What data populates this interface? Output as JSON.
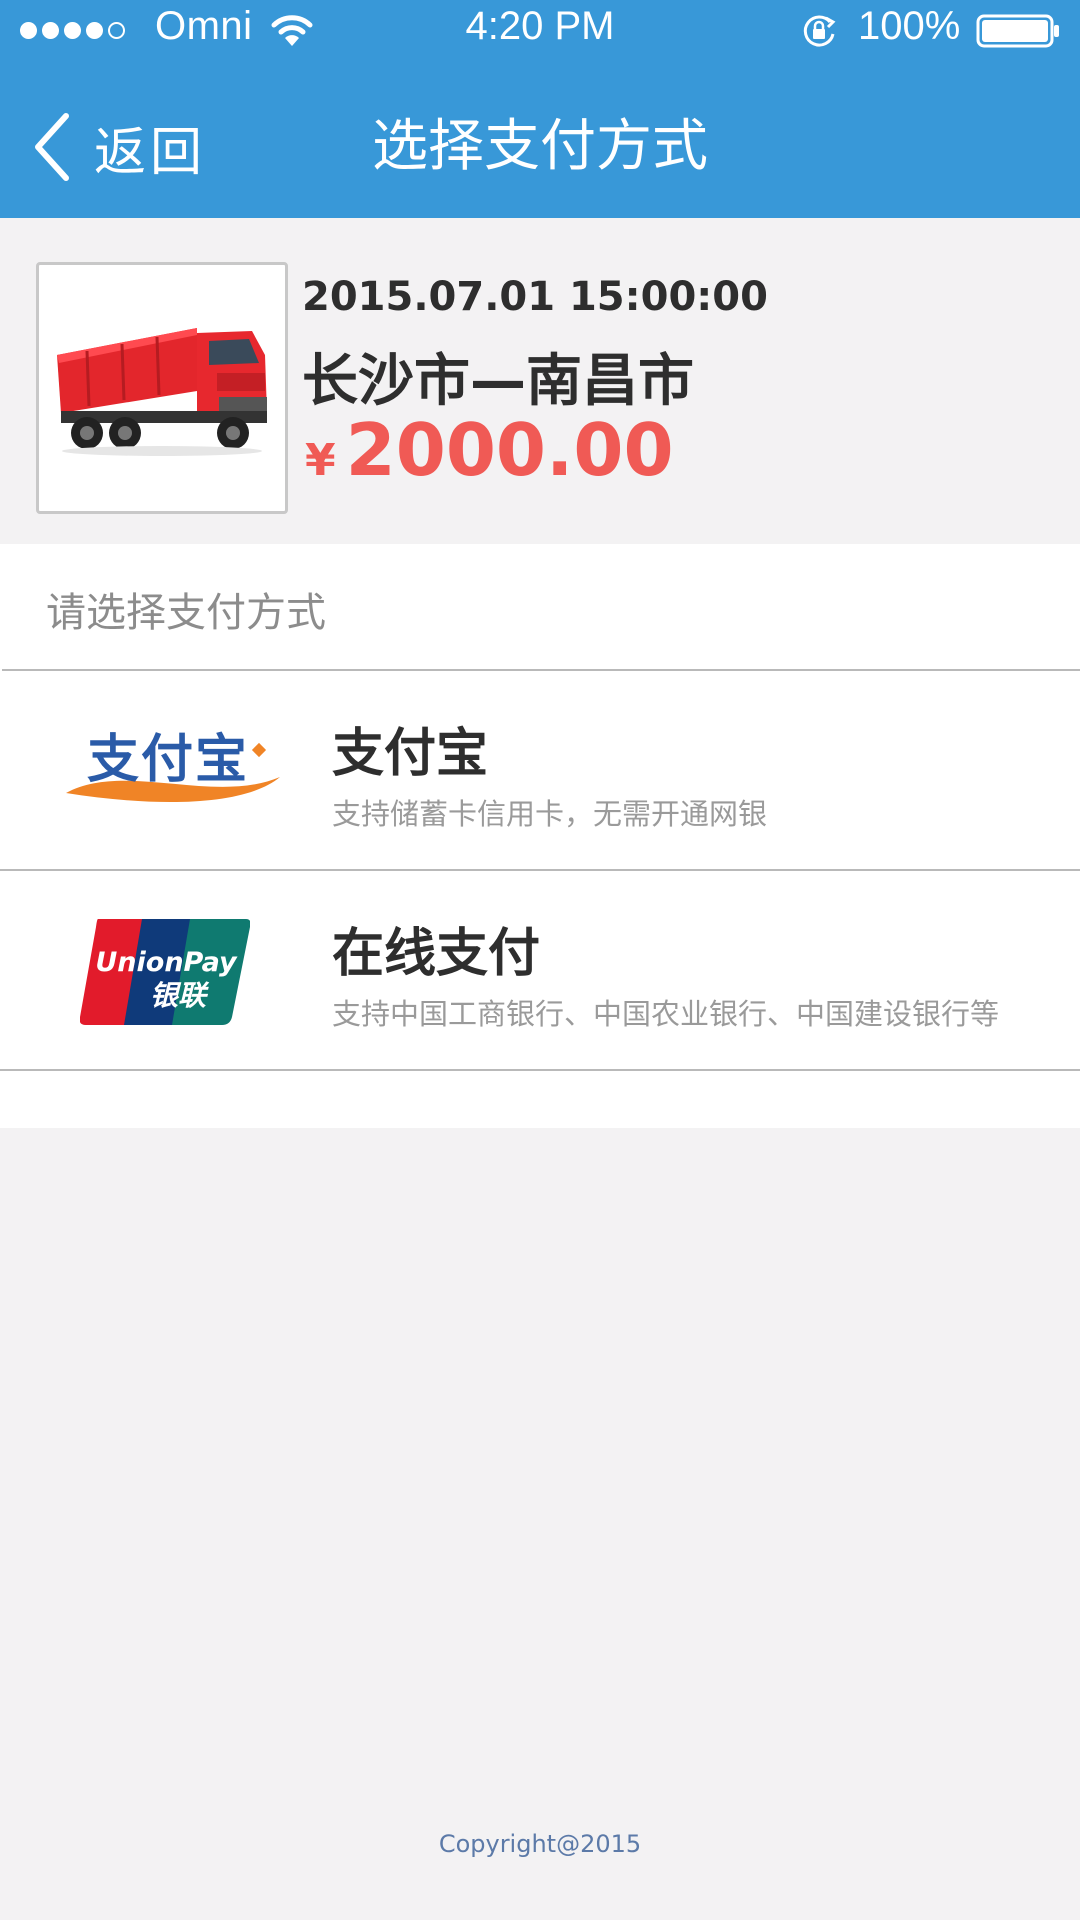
{
  "status_bar": {
    "carrier": "Omni",
    "time": "4:20 PM",
    "battery": "100%",
    "signal_bars_filled": 4,
    "signal_bars_total": 5
  },
  "nav": {
    "back_label": "返回",
    "title": "选择支付方式"
  },
  "order": {
    "datetime": "2015.07.01 15:00:00",
    "route": "长沙市—南昌市",
    "currency_symbol": "¥",
    "amount": "2000.00",
    "image_icon": "truck-image"
  },
  "payment": {
    "prompt": "请选择支付方式",
    "options": [
      {
        "name": "支付宝",
        "description": "支持储蓄卡信用卡，无需开通网银",
        "logo_text": "支付宝",
        "icon": "alipay-logo"
      },
      {
        "name": "在线支付",
        "description": "支持中国工商银行、中国农业银行、中国建设银行等",
        "logo_text_top": "UnionPay",
        "logo_text_bottom": "银联",
        "icon": "unionpay-logo"
      }
    ]
  },
  "footer": {
    "copyright": "Copyright@2015"
  },
  "colors": {
    "header_bg": "#3898d8",
    "price": "#f05a55",
    "page_bg": "#f3f2f3"
  }
}
